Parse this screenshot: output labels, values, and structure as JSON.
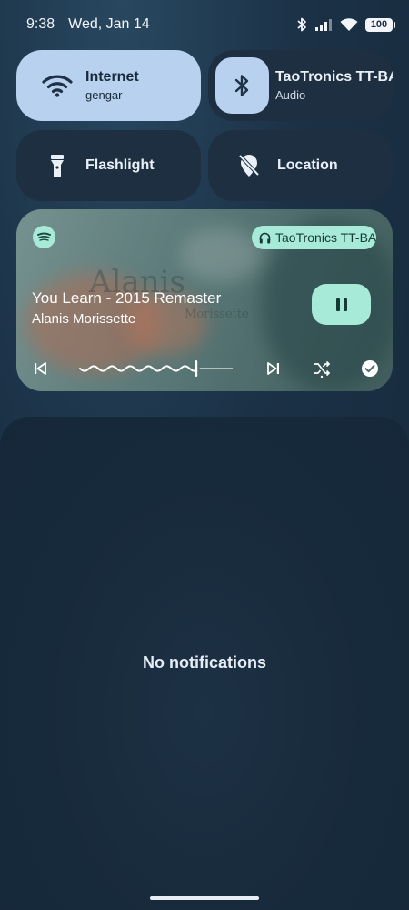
{
  "status_bar": {
    "time": "9:38",
    "date": "Wed, Jan 14",
    "battery": "100",
    "icons": [
      "bluetooth-icon",
      "signal-icon",
      "wifi-icon",
      "battery-icon"
    ]
  },
  "quick_tiles": {
    "internet": {
      "title": "Internet",
      "subtitle": "gengar",
      "icon": "wifi-icon",
      "active": true
    },
    "bluetooth": {
      "title": "TaoTronics TT-BA",
      "subtitle": "Audio",
      "icon": "bluetooth-icon",
      "active": true
    },
    "flashlight": {
      "title": "Flashlight",
      "icon": "flashlight-icon",
      "active": false
    },
    "location": {
      "title": "Location",
      "icon": "location-off-icon",
      "active": false
    }
  },
  "media": {
    "app_icon": "spotify-icon",
    "output_device": "TaoTronics TT-BA",
    "song_title": "You Learn - 2015 Remaster",
    "artist": "Alanis Morissette",
    "album_art_text": {
      "line1": "Alanis",
      "line2": "Morissette"
    },
    "progress": 0.76,
    "state": "playing",
    "accent": "#a8ead8"
  },
  "notifications": {
    "empty_message": "No notifications"
  },
  "colors": {
    "tile_active": "#b7d1ef",
    "tile_inactive": "#1d2f41",
    "background": "#172a3c"
  }
}
